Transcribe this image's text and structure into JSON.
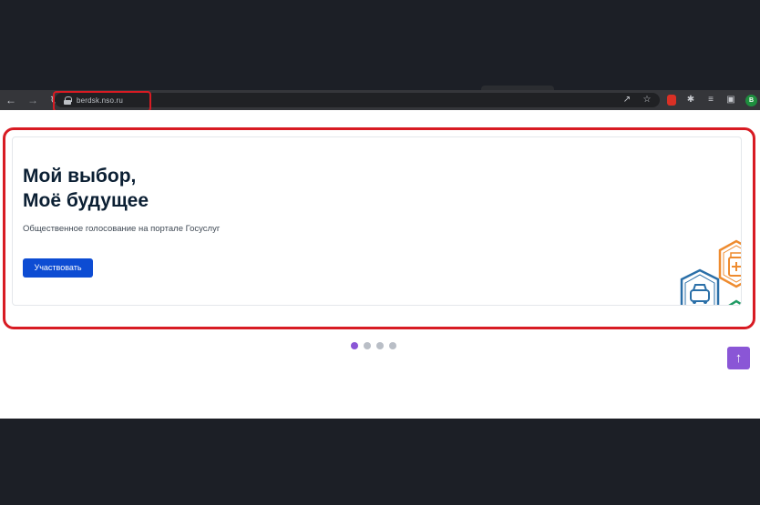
{
  "browser": {
    "url": "berdsk.nso.ru",
    "avatar_letter": "B"
  },
  "banner": {
    "title_line1": "Мой выбор,",
    "title_line2": "Моё будущее",
    "subtitle": "Общественное голосование на портале Госуслуг",
    "button_label": "Участвовать"
  },
  "carousel": {
    "slide_count": 4,
    "active_index": 0
  },
  "colors": {
    "highlight": "#d81b23",
    "button": "#0d4cd3",
    "carousel_active": "#8a56d6",
    "scroll_up": "#8a56d6"
  },
  "icons": [
    "back-icon",
    "forward-icon",
    "reload-icon",
    "lock-icon",
    "share-icon",
    "star-icon",
    "extension-icon",
    "puzzle-icon",
    "media-icon",
    "sidebar-icon",
    "arrow-up-icon"
  ]
}
